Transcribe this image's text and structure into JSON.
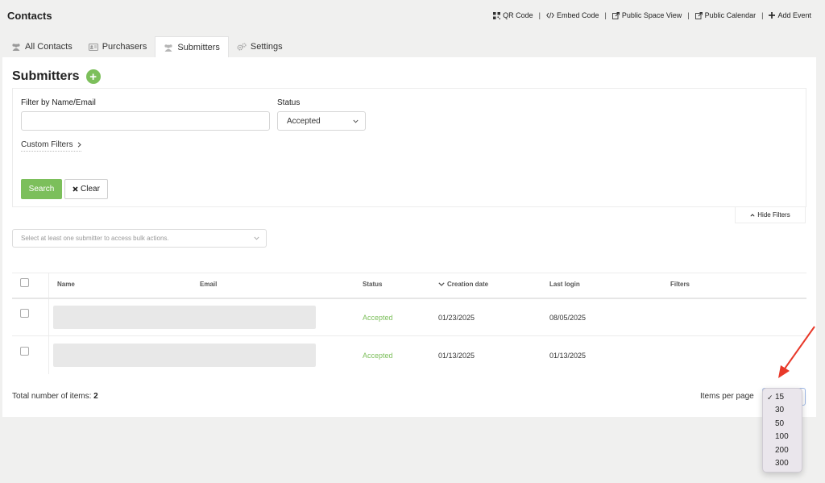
{
  "app": {
    "title": "Contacts"
  },
  "top_actions": [
    {
      "label": "QR Code",
      "icon": "qr-icon"
    },
    {
      "label": "Embed Code",
      "icon": "code-icon"
    },
    {
      "label": "Public Space View",
      "icon": "external-link-icon"
    },
    {
      "label": "Public Calendar",
      "icon": "external-link-icon"
    },
    {
      "label": "Add Event",
      "icon": "plus-icon"
    }
  ],
  "tabs": [
    {
      "label": "All Contacts",
      "icon": "users-icon",
      "active": false
    },
    {
      "label": "Purchasers",
      "icon": "id-card-icon",
      "active": false
    },
    {
      "label": "Submitters",
      "icon": "users-icon",
      "active": true
    },
    {
      "label": "Settings",
      "icon": "gears-icon",
      "active": false
    }
  ],
  "page": {
    "heading": "Submitters"
  },
  "filters": {
    "name_label": "Filter by Name/Email",
    "name_value": "",
    "status_label": "Status",
    "status_value": "Accepted",
    "custom_filters_label": "Custom Filters",
    "search_label": "Search",
    "clear_label": "Clear",
    "hide_filters_label": "Hide Filters"
  },
  "bulk": {
    "placeholder": "Select at least one submitter to access bulk actions."
  },
  "table": {
    "columns": {
      "name": "Name",
      "email": "Email",
      "status": "Status",
      "creation_date": "Creation date",
      "last_login": "Last login",
      "filters": "Filters"
    },
    "sorted_by": "creation_date",
    "rows": [
      {
        "status": "Accepted",
        "creation_date": "01/23/2025",
        "last_login": "08/05/2025"
      },
      {
        "status": "Accepted",
        "creation_date": "01/13/2025",
        "last_login": "01/13/2025"
      }
    ]
  },
  "footer": {
    "total_label": "Total number of items:",
    "total_value": "2",
    "items_per_page_label": "Items per page"
  },
  "items_per_page_options": [
    "15",
    "30",
    "50",
    "100",
    "200",
    "300"
  ],
  "items_per_page_selected": "15",
  "colors": {
    "accent_green": "#7cbf5b",
    "annotation_red": "#e8392a"
  }
}
